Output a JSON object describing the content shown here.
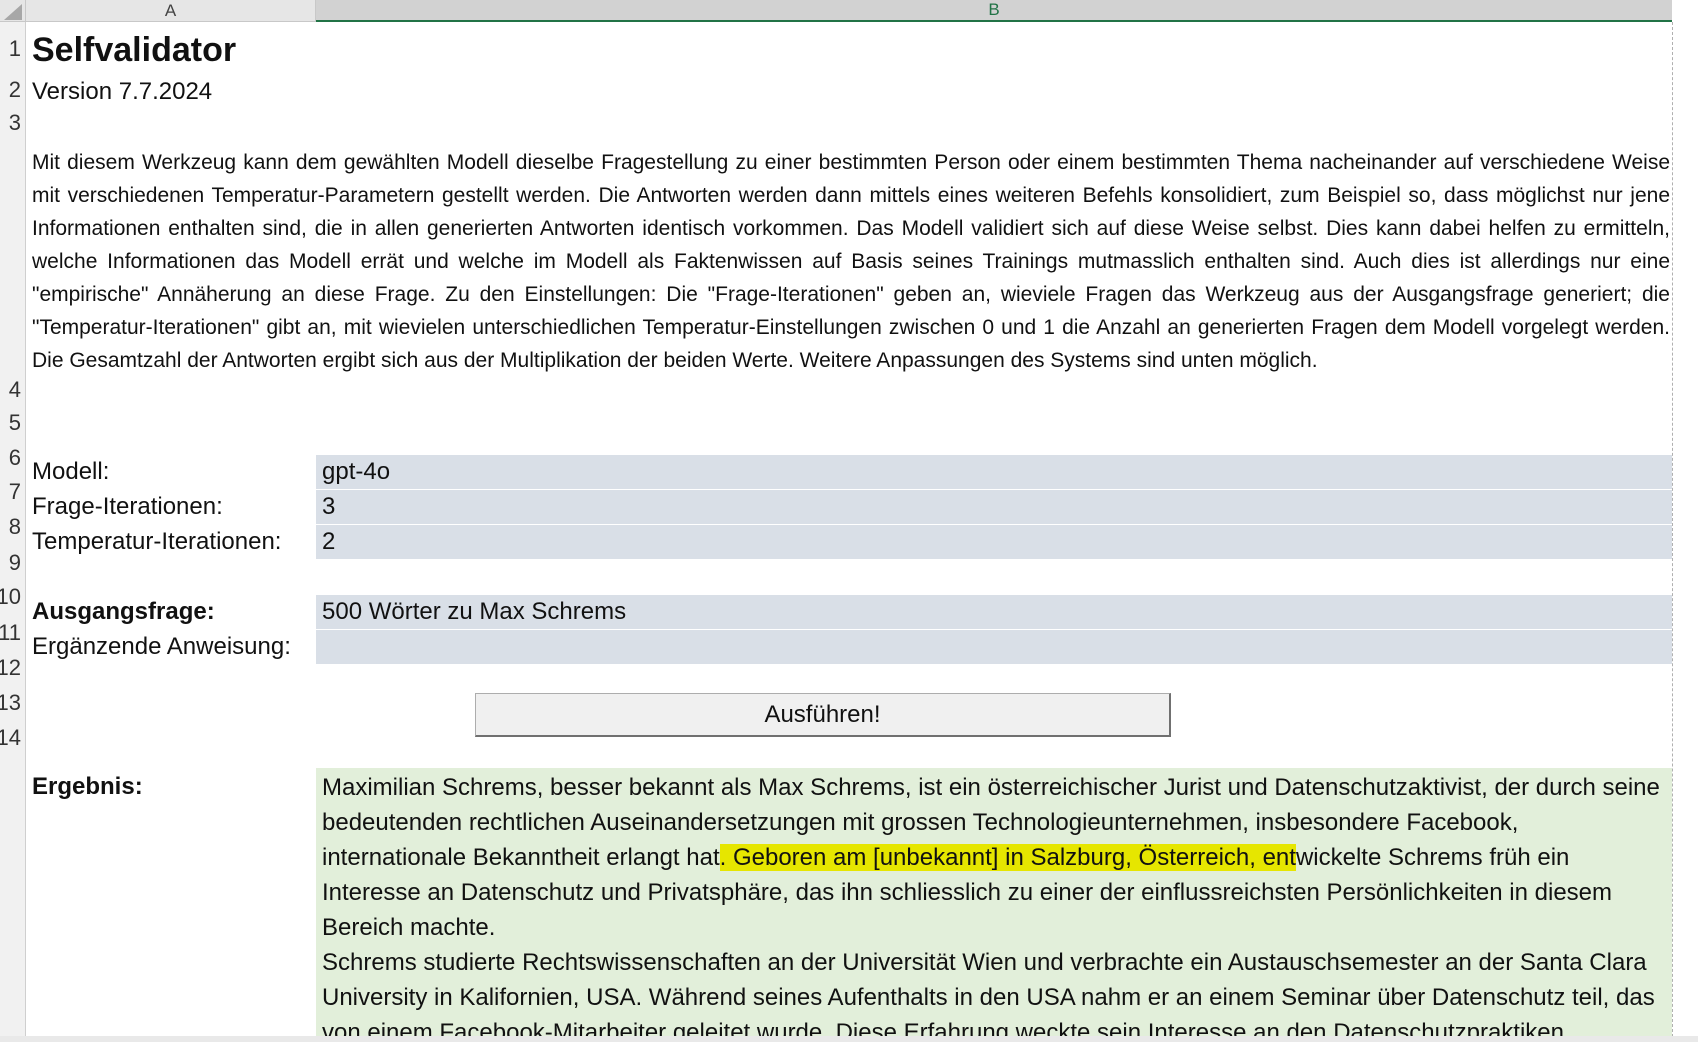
{
  "columns": [
    "A",
    "B"
  ],
  "rows": [
    "1",
    "2",
    "3",
    "4",
    "5",
    "6",
    "7",
    "8",
    "9",
    "10",
    "11",
    "12",
    "13",
    "14"
  ],
  "title": "Selfvalidator",
  "version": "Version 7.7.2024",
  "description": "Mit diesem Werkzeug kann dem gewählten Modell dieselbe Fragestellung zu einer bestimmten Person oder einem bestimmten Thema nacheinander auf verschiedene Weise mit verschiedenen Temperatur-Parametern gestellt werden. Die Antworten werden dann mittels eines weiteren Befehls konsolidiert, zum Beispiel so, dass möglichst nur jene Informationen enthalten sind, die in allen generierten Antworten identisch vorkommen. Das Modell validiert sich auf diese Weise selbst. Dies kann dabei helfen zu ermitteln, welche Informationen das Modell errät und welche im Modell als Faktenwissen auf Basis seines Trainings mutmasslich enthalten sind. Auch dies ist allerdings nur eine \"empirische\" Annäherung an diese Frage. Zu den Einstellungen: Die \"Frage-Iterationen\" geben an, wieviele Fragen das Werkzeug aus der Ausgangsfrage generiert; die \"Temperatur-Iterationen\" gibt an, mit wievielen unterschiedlichen Temperatur-Einstellungen zwischen 0 und 1 die Anzahl an generierten Fragen dem Modell vorgelegt werden. Die Gesamtzahl der Antworten ergibt sich aus der Multiplikation der beiden Werte. Weitere Anpassungen des Systems sind unten möglich.",
  "fields": {
    "model_label": "Modell:",
    "model_value": "gpt-4o",
    "question_iter_label": "Frage-Iterationen:",
    "question_iter_value": "3",
    "temp_iter_label": "Temperatur-Iterationen:",
    "temp_iter_value": "2",
    "base_question_label": "Ausgangsfrage:",
    "base_question_value": "500 Wörter zu Max Schrems",
    "extra_instruction_label": "Ergänzende Anweisung:",
    "extra_instruction_value": ""
  },
  "run_button": "Ausführen!",
  "result": {
    "label": "Ergebnis:",
    "p1_before": "Maximilian Schrems, besser bekannt als Max Schrems, ist ein österreichischer Jurist und Datenschutzaktivist, der durch seine bedeutenden rechtlichen Auseinandersetzungen mit grossen Technologieunternehmen, insbesondere Facebook, internationale Bekanntheit erlangt hat",
    "p1_highlight": ". Geboren am [unbekannt] in Salzburg, Österreich, ent",
    "p1_after": "wickelte Schrems früh ein Interesse an Datenschutz und Privatsphäre, das ihn schliesslich zu einer der einflussreichsten Persönlichkeiten in diesem Bereich machte.",
    "p2": "Schrems studierte Rechtswissenschaften an der Universität Wien und verbrachte ein Austauschsemester an der Santa Clara University in Kalifornien, USA. Während seines Aufenthalts in den USA nahm er an einem Seminar über Datenschutz teil, das von einem Facebook-Mitarbeiter geleitet wurde. Diese Erfahrung weckte sein Interesse an den Datenschutzpraktiken"
  },
  "colors": {
    "input_bg": "#d9dfe7",
    "result_bg": "#e2efda",
    "highlight": "#e6e600",
    "header_accent": "#217346"
  }
}
